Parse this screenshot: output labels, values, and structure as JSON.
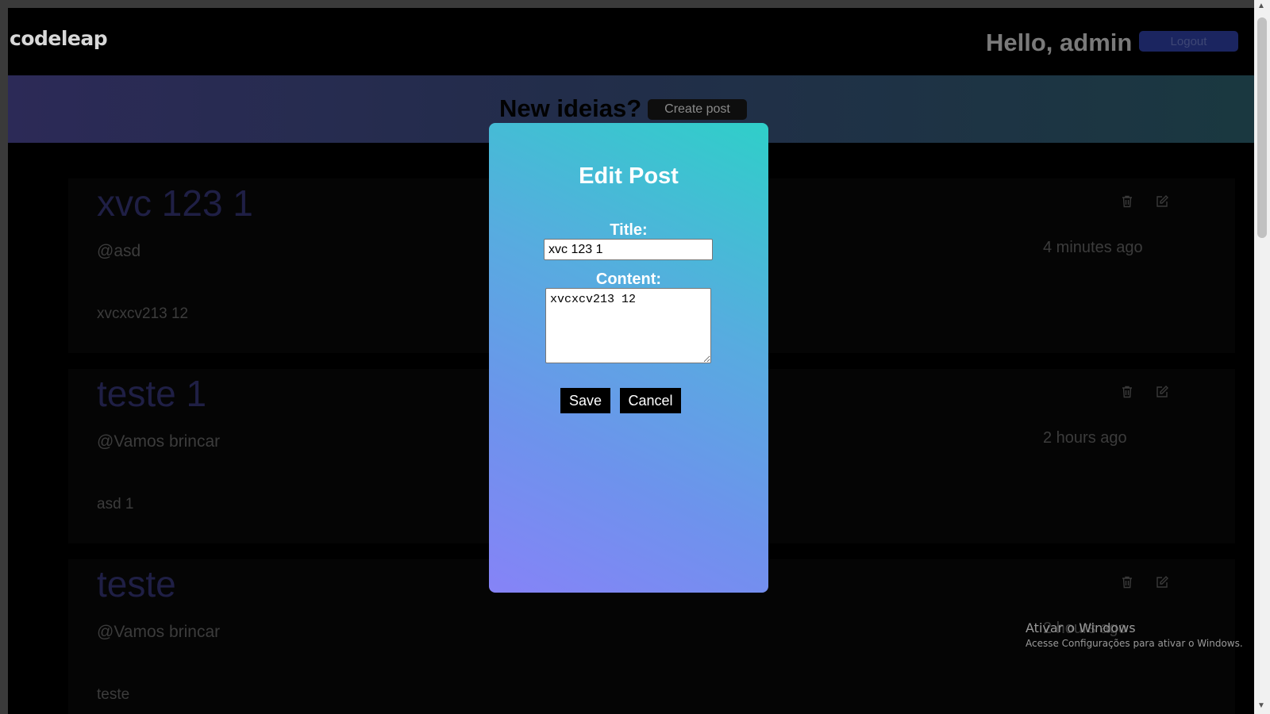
{
  "header": {
    "logo": "codeleap",
    "greeting": "Hello, admin",
    "logout_label": "Logout"
  },
  "banner": {
    "title": "New ideias?",
    "create_label": "Create post"
  },
  "posts": [
    {
      "title": "xvc 123 1",
      "username": "@asd",
      "time": "4 minutes ago",
      "content": "xvcxcv213 12"
    },
    {
      "title": "teste 1",
      "username": "@Vamos brincar",
      "time": "2 hours ago",
      "content": "asd 1"
    },
    {
      "title": "teste",
      "username": "@Vamos brincar",
      "time": "2 hours ago",
      "content": "teste"
    }
  ],
  "modal": {
    "title": "Edit Post",
    "title_label": "Title:",
    "title_value": "xvc 123 1",
    "content_label": "Content:",
    "content_value": "xvcxcv213 12",
    "save_label": "Save",
    "cancel_label": "Cancel"
  },
  "watermark": {
    "line1": "Ativar o Windows",
    "line2": "Acesse Configurações para ativar o Windows."
  },
  "icons": {
    "delete": "trash-icon",
    "edit": "edit-icon"
  },
  "colors": {
    "background": "#000000",
    "modal_start": "#2fcfc9",
    "modal_end": "#8683f7",
    "button": "#000000"
  }
}
